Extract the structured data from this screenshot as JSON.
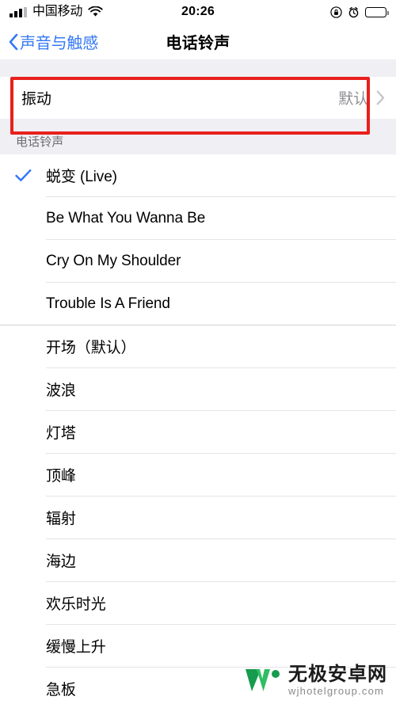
{
  "status_bar": {
    "carrier": "中国移动",
    "time": "20:26",
    "icons": {
      "signal": "signal-bars-icon",
      "wifi": "wifi-icon",
      "rotation_lock": "rotation-lock-icon",
      "alarm": "alarm-clock-icon",
      "battery": "battery-icon"
    }
  },
  "nav": {
    "back_label": "声音与触感",
    "title": "电话铃声"
  },
  "vibration_row": {
    "title": "振动",
    "value": "默认",
    "disclosure": "chevron-right-icon"
  },
  "section": {
    "header": "电话铃声"
  },
  "custom_tones": [
    {
      "label": "蜕变 (Live)",
      "selected": true
    },
    {
      "label": "Be What You Wanna Be",
      "selected": false
    },
    {
      "label": "Cry On My Shoulder",
      "selected": false
    },
    {
      "label": "Trouble Is A Friend",
      "selected": false
    }
  ],
  "default_tones": [
    {
      "label": "开场（默认）",
      "selected": false
    },
    {
      "label": "波浪",
      "selected": false
    },
    {
      "label": "灯塔",
      "selected": false
    },
    {
      "label": "顶峰",
      "selected": false
    },
    {
      "label": "辐射",
      "selected": false
    },
    {
      "label": "海边",
      "selected": false
    },
    {
      "label": "欢乐时光",
      "selected": false
    },
    {
      "label": "缓慢上升",
      "selected": false
    },
    {
      "label": "急板",
      "selected": false
    }
  ],
  "watermark": {
    "title": "无极安卓网",
    "url": "wjhotelgroup.com",
    "logo": "w-logo-icon"
  },
  "colors": {
    "accent_blue": "#3478f6",
    "highlight_red": "#e8201d",
    "group_background": "#efeff4",
    "secondary_text": "#8e8e93",
    "logo_green_dark": "#169b4f",
    "logo_green_light": "#2fbe62"
  }
}
